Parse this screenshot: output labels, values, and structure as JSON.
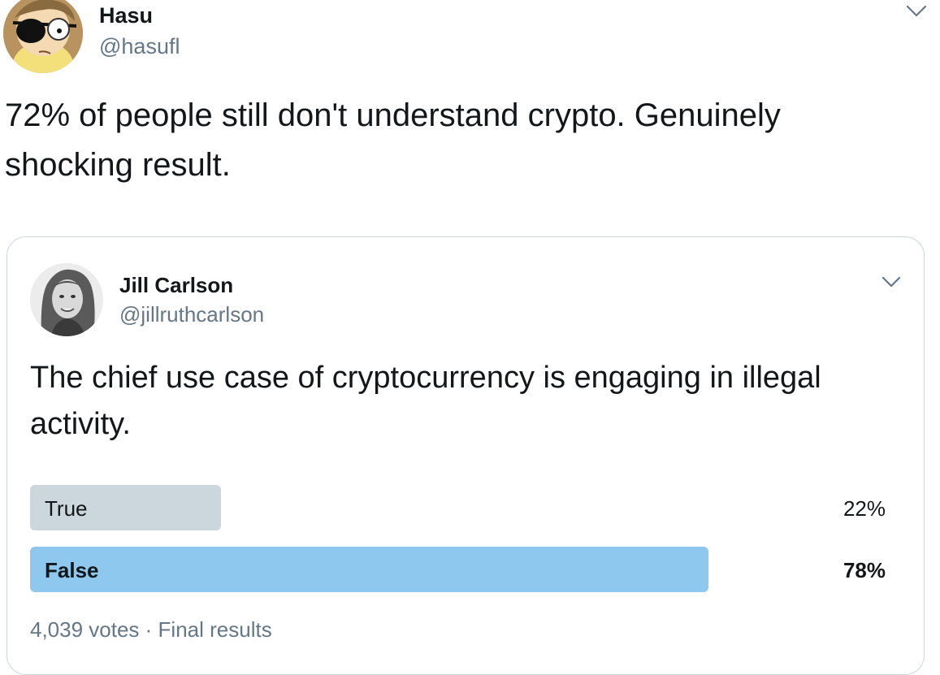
{
  "tweet": {
    "author_name": "Hasu",
    "author_handle": "@hasufl",
    "text": "72% of people still don't understand crypto. Genuinely shocking result.",
    "avatar_icon": "cartoon-avatar-icon",
    "menu_icon": "chevron-down-icon"
  },
  "quoted_tweet": {
    "author_name": "Jill Carlson",
    "author_handle": "@jillruthcarlson",
    "text": "The chief use case of cryptocurrency is engaging in illegal activity.",
    "avatar_icon": "profile-photo-icon",
    "menu_icon": "chevron-down-icon",
    "poll": {
      "options": [
        {
          "label": "True",
          "percent_label": "22%",
          "fraction": 0.22,
          "winner": false,
          "color": "#ccd6dd"
        },
        {
          "label": "False",
          "percent_label": "78%",
          "fraction": 0.78,
          "winner": true,
          "color": "#8ec8ee"
        }
      ],
      "votes": "4,039 votes",
      "separator": " · ",
      "status": "Final results"
    }
  },
  "colors": {
    "text_primary": "#14171a",
    "text_secondary": "#657786",
    "border": "#ccd6dd"
  }
}
